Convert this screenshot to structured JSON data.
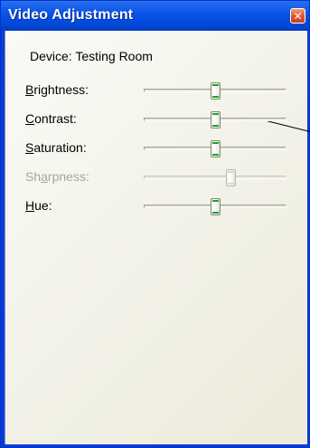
{
  "window": {
    "title": "Video Adjustment",
    "close_glyph": "✕"
  },
  "device_label": "Device: Testing Room",
  "sliders": [
    {
      "label": "Brightness:",
      "mnemonic": "B",
      "rest": "rightness:",
      "value": 0.5,
      "enabled": true
    },
    {
      "label": "Contrast:",
      "mnemonic": "C",
      "rest": "ontrast:",
      "value": 0.5,
      "enabled": true
    },
    {
      "label": "Saturation:",
      "mnemonic": "S",
      "rest": "aturation:",
      "value": 0.5,
      "enabled": true
    },
    {
      "label": "Sharpness:",
      "pre": "Sh",
      "mnemonic": "a",
      "rest": "rpness:",
      "value": 0.62,
      "enabled": false
    },
    {
      "label": "Hue:",
      "mnemonic": "H",
      "rest": "ue:",
      "value": 0.5,
      "enabled": true
    }
  ],
  "colors": {
    "titlebar": "#0a55e8",
    "close": "#e0512b",
    "thumb_accent": "#21a121"
  }
}
